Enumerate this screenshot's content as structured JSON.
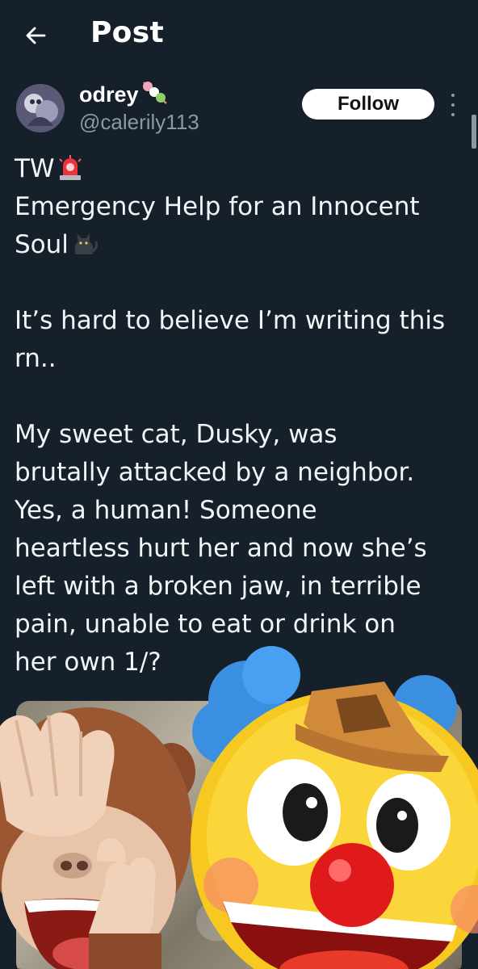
{
  "header": {
    "title": "Post",
    "back_icon": "arrow-left-icon"
  },
  "author": {
    "display_name": "odrey",
    "name_emoji": "dango-icon",
    "handle": "@calerily113",
    "follow_label": "Follow",
    "more_icon": "more-vertical-icon"
  },
  "post": {
    "lines": [
      "TW",
      "Emergency Help for an Innocent",
      "Soul",
      "",
      "It’s hard to believe I’m writing this",
      "rn..",
      "",
      "My sweet cat, Dusky, was",
      "brutally attacked by a neighbor.",
      "Yes, a human! Someone",
      "heartless hurt her and now she’s",
      "left with a broken jaw, in terrible",
      "pain, unable to eat or drink on",
      "her own 1/?"
    ],
    "line0_emoji": "police-light-icon",
    "line2_emoji": "black-cat-icon"
  },
  "overlay": {
    "left_emoji": "see-no-evil-monkey-icon",
    "right_emoji": "clown-face-icon"
  },
  "colors": {
    "background": "#15202b",
    "secondary_text": "#8b98a5",
    "follow_bg": "#ffffff"
  }
}
